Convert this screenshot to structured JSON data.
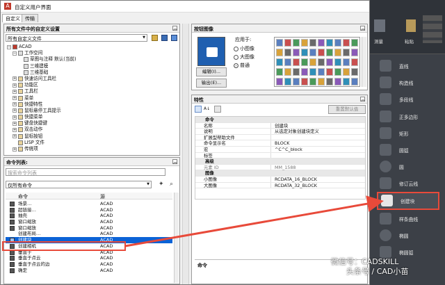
{
  "window": {
    "title": "自定义用户界面"
  },
  "tabs": [
    "自定义",
    "传输"
  ],
  "customizations_panel": {
    "title": "所有文件中的自定义设置",
    "dropdown": "所有自定义文件",
    "tree": [
      {
        "label": "ACAD",
        "level": 0
      },
      {
        "label": "工作空间",
        "level": 1
      },
      {
        "label": "草图与注释 默认(当前)",
        "level": 2
      },
      {
        "label": "三维建模",
        "level": 2
      },
      {
        "label": "三维基础",
        "level": 2
      },
      {
        "label": "快速访问工具栏",
        "level": 1
      },
      {
        "label": "功能区",
        "level": 1
      },
      {
        "label": "工具栏",
        "level": 1
      },
      {
        "label": "菜单",
        "level": 1
      },
      {
        "label": "快捷特性",
        "level": 1
      },
      {
        "label": "鼠标悬停工具提示",
        "level": 1
      },
      {
        "label": "快捷菜单",
        "level": 1
      },
      {
        "label": "键盘快捷键",
        "level": 1
      },
      {
        "label": "双击动作",
        "level": 1
      },
      {
        "label": "鼠标按钮",
        "level": 1
      },
      {
        "label": "LISP 文件",
        "level": 1
      },
      {
        "label": "传统项",
        "level": 1
      }
    ]
  },
  "command_list": {
    "title": "命令列表:",
    "search_placeholder": "搜索命令列表",
    "filter": "仅所有命令",
    "col_command": "命令",
    "col_source": "源",
    "rows": [
      {
        "name": "场景…",
        "source": "ACAD"
      },
      {
        "name": "超链接…",
        "source": "ACAD"
      },
      {
        "name": "抽壳",
        "source": "ACAD"
      },
      {
        "name": "窗口缩放",
        "source": "ACAD"
      },
      {
        "name": "窗口缩放",
        "source": "ACAD"
      },
      {
        "name": "创建布局…",
        "source": "ACAD"
      },
      {
        "name": "创建块",
        "source": "ACAD",
        "selected": true
      },
      {
        "name": "创建相机",
        "source": "ACAD"
      },
      {
        "name": "垂直于",
        "source": "ACAD"
      },
      {
        "name": "垂直于点云",
        "source": "ACAD"
      },
      {
        "name": "垂直于点云的边",
        "source": "ACAD"
      },
      {
        "name": "确定",
        "source": "ACAD"
      }
    ]
  },
  "button_image": {
    "title": "按钮图像",
    "apply_to_label": "应用于:",
    "options": [
      "小图像",
      "大图像",
      "普通"
    ],
    "selected_option": "普通",
    "edit_button": "编辑(I)...",
    "export_button": "输出(E)..."
  },
  "properties": {
    "title": "特性",
    "reset_button": "重置默认值",
    "sections": [
      {
        "name": "命令",
        "rows": [
          {
            "key": "名称",
            "value": "创建块"
          },
          {
            "key": "说明",
            "value": "从选定对象创建块定义"
          },
          {
            "key": "扩展型帮助文件",
            "value": ""
          },
          {
            "key": "命令显示名",
            "value": "BLOCK"
          },
          {
            "key": "宏",
            "value": "^C^C_block"
          },
          {
            "key": "标签",
            "value": ""
          }
        ]
      },
      {
        "name": "高级",
        "rows": [
          {
            "key": "元素 ID",
            "value": "MM_1588"
          }
        ]
      },
      {
        "name": "图像",
        "rows": [
          {
            "key": "小图像",
            "value": "RCDATA_16_BLOCK"
          },
          {
            "key": "大图像",
            "value": "RCDATA_32_BLOCK"
          }
        ]
      }
    ],
    "footer_label": "命令"
  },
  "ribbon": {
    "top_labels": [
      "测量",
      "粘贴"
    ],
    "items": [
      "直线",
      "构造线",
      "多段线",
      "正多边形",
      "矩形",
      "圆弧",
      "圆",
      "修订云线",
      "创建块",
      "样条曲线",
      "椭圆",
      "椭圆弧"
    ],
    "selected_item": "创建块"
  },
  "watermark": {
    "line1": "微信号：CADSKILL",
    "line2": "头条号 / CAD小苗"
  },
  "colors": {
    "selection": "#0b63d6",
    "arrow": "#e84a3a",
    "ribbon_bg": "#3c4047"
  }
}
